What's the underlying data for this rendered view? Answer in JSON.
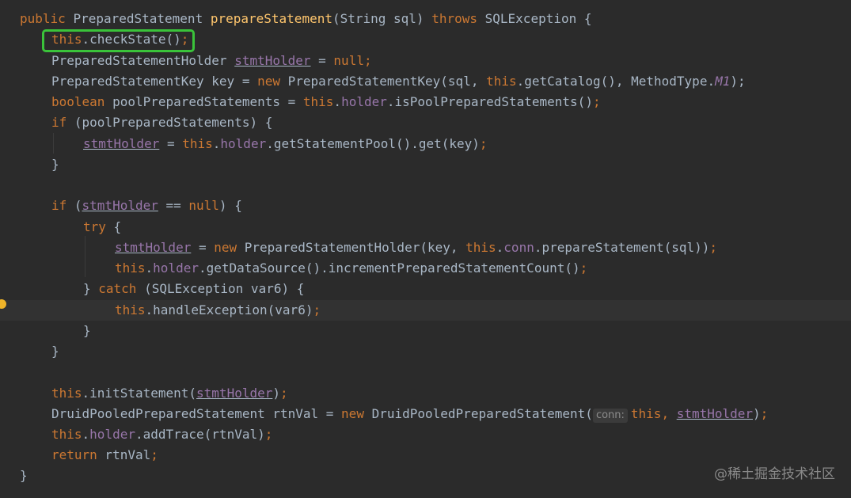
{
  "code": {
    "line1": {
      "t1": "public",
      "t2": "PreparedStatement",
      "t3": "prepareStatement",
      "t4": "(String sql)",
      "t5": "throws",
      "t6": "SQLException {"
    },
    "line2": {
      "t1": "this",
      "t2": ".checkState()",
      "t3": ";"
    },
    "line3": {
      "t1": "PreparedStatementHolder ",
      "t2": "stmtHolder",
      "t3": " = ",
      "t4": "null",
      ";": ";"
    },
    "line4": {
      "t1": "PreparedStatementKey key = ",
      "t2": "new",
      "t3": " PreparedStatementKey(sql, ",
      "t4": "this",
      "t5": ".getCatalog(), MethodType.",
      "t6": "M1",
      "t7": ");"
    },
    "line5": {
      "t1": "boolean",
      "t2": " poolPreparedStatements = ",
      "t3": "this",
      "t4": ".",
      "t5": "holder",
      "t6": ".isPoolPreparedStatements()",
      "t7": ";"
    },
    "line6": {
      "t1": "if",
      "t2": " (poolPreparedStatements) {"
    },
    "line7": {
      "t1": "stmtHolder",
      "t2": " = ",
      "t3": "this",
      "t4": ".",
      "t5": "holder",
      "t6": ".getStatementPool().get(key)",
      "t7": ";"
    },
    "line8": {
      "t1": "}"
    },
    "line10": {
      "t1": "if",
      "t2": " (",
      "t3": "stmtHolder",
      "t4": " == ",
      "t5": "null",
      "t6": ") {"
    },
    "line11": {
      "t1": "try",
      "t2": " {"
    },
    "line12": {
      "t1": "stmtHolder",
      "t2": " = ",
      "t3": "new",
      "t4": " PreparedStatementHolder(key, ",
      "t5": "this",
      "t6": ".",
      "t7": "conn",
      "t8": ".prepareStatement(sql))",
      "t9": ";"
    },
    "line13": {
      "t1": "this",
      "t2": ".",
      "t3": "holder",
      "t4": ".getDataSource().incrementPreparedStatementCount()",
      "t5": ";"
    },
    "line14": {
      "t1": "} ",
      "t2": "catch",
      "t3": " (SQLException var6) {"
    },
    "line15": {
      "t1": "this",
      "t2": ".handleException(var6)",
      "t3": ";"
    },
    "line16": {
      "t1": "}"
    },
    "line17": {
      "t1": "}"
    },
    "line19": {
      "t1": "this",
      "t2": ".initStatement(",
      "t3": "stmtHolder",
      "t4": ")",
      "t5": ";"
    },
    "line20": {
      "t1": "DruidPooledPreparedStatement rtnVal = ",
      "t2": "new",
      "t3": " DruidPooledPreparedStatement(",
      "hint": "conn:",
      "t4": "this",
      ",": ", ",
      "t5": "stmtHolder",
      "t6": ")",
      "t7": ";"
    },
    "line21": {
      "t1": "this",
      "t2": ".",
      "t3": "holder",
      "t4": ".addTrace(rtnVal)",
      "t5": ";"
    },
    "line22": {
      "t1": "return",
      "t2": " rtnVal",
      "t3": ";"
    },
    "line23": {
      "t1": "}"
    }
  },
  "watermark": "@稀土掘金技术社区",
  "colors": {
    "background": "#2b2b2b",
    "keyword": "#cc7832",
    "method": "#ffc66d",
    "field": "#9876aa",
    "text": "#a9b7c6",
    "highlight": "#3ac33a"
  }
}
